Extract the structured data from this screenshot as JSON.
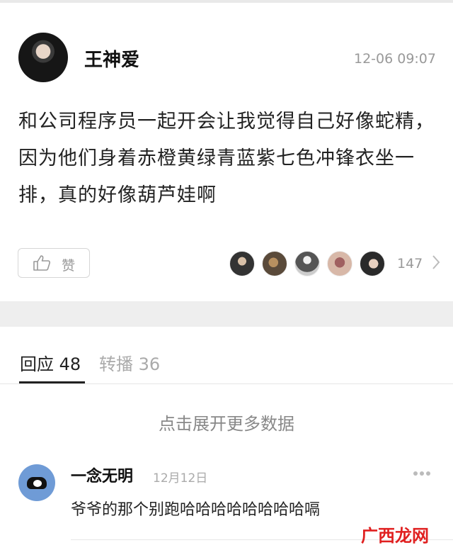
{
  "post": {
    "author": "王神爱",
    "timestamp": "12-06 09:07",
    "text": "和公司程序员一起开会让我觉得自己好像蛇精，因为他们身着赤橙黄绿青蓝紫七色冲锋衣坐一排，真的好像葫芦娃啊",
    "like_label": "赞",
    "like_count": "147"
  },
  "tabs": [
    {
      "label": "回应 48"
    },
    {
      "label": "转播 36"
    }
  ],
  "load_more": "点击展开更多数据",
  "comment": {
    "author": "一念无明",
    "date": "12月12日",
    "text": "爷爷的那个别跑哈哈哈哈哈哈哈哈嗝"
  },
  "watermark": "广西龙网",
  "colors": {
    "accent_tab": "#222222",
    "muted_text": "#999999",
    "watermark": "#e02020"
  }
}
